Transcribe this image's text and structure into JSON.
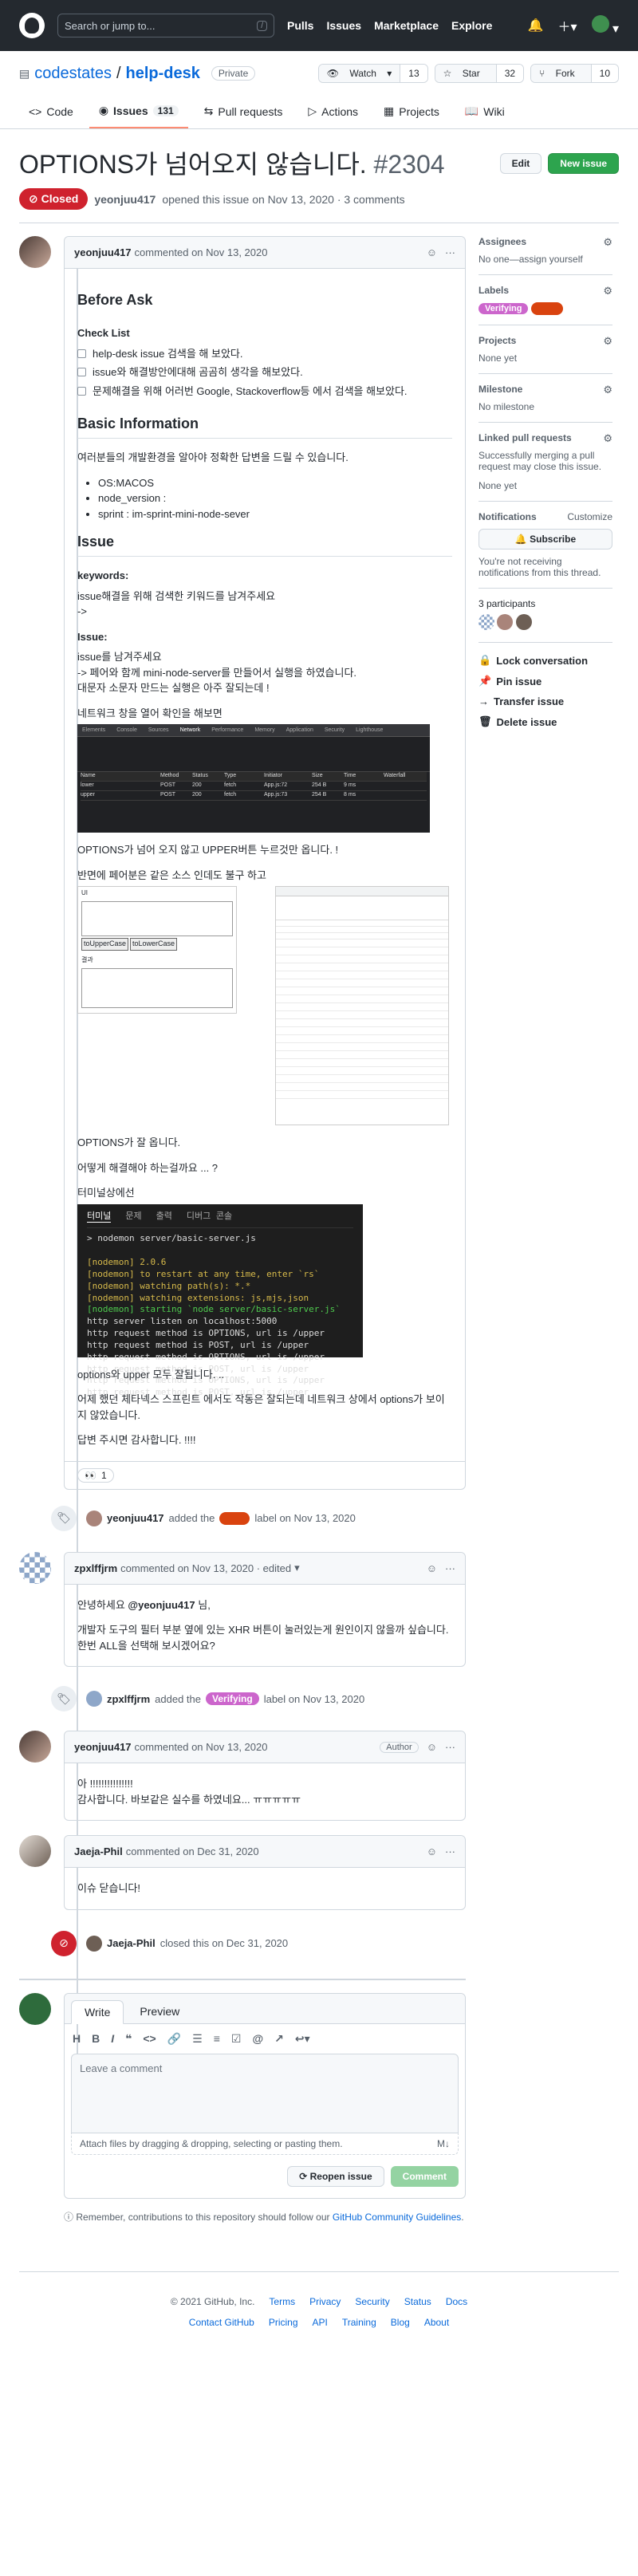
{
  "header": {
    "search_placeholder": "Search or jump to...",
    "search_kbd": "/",
    "nav": [
      "Pulls",
      "Issues",
      "Marketplace",
      "Explore"
    ]
  },
  "repo": {
    "owner": "codestates",
    "name": "help-desk",
    "visibility": "Private",
    "watch_label": "Watch",
    "watch_count": "13",
    "star_label": "Star",
    "star_count": "32",
    "fork_label": "Fork",
    "fork_count": "10",
    "tabs": [
      {
        "label": "Code",
        "icon": "code-icon"
      },
      {
        "label": "Issues",
        "icon": "issue-icon",
        "count": "131",
        "selected": true
      },
      {
        "label": "Pull requests",
        "icon": "pr-icon"
      },
      {
        "label": "Actions",
        "icon": "play-icon"
      },
      {
        "label": "Projects",
        "icon": "project-icon"
      },
      {
        "label": "Wiki",
        "icon": "book-icon"
      }
    ]
  },
  "issue": {
    "title": "OPTIONS가 넘어오지 않습니다.",
    "number": "#2304",
    "edit_label": "Edit",
    "new_issue_label": "New issue",
    "state": "Closed",
    "author": "yeonjuu417",
    "opened_text": "opened this issue on Nov 13, 2020 · 3 comments"
  },
  "first_comment": {
    "author": "yeonjuu417",
    "date_text": "commented on Nov 13, 2020",
    "before_ask": "Before Ask",
    "check_list": "Check List",
    "checks": [
      "help-desk issue 검색을 해 보았다.",
      "issue와 해결방안에대해 곰곰히 생각을 해보았다.",
      "문제해결을 위해 어러번 Google, Stackoverflow등 에서 검색을 해보았다."
    ],
    "basic_info": "Basic Information",
    "basic_intro": "여러분들의 개발환경을 알아야 정확한 답변을 드릴 수 있습니다.",
    "env": [
      "OS:MACOS",
      "node_version :",
      "sprint : im-sprint-mini-node-sever"
    ],
    "issue_heading": "Issue",
    "keywords_heading": "keywords:",
    "keywords_text1": "issue해결을 위해 검색한 키워드를 남겨주세요",
    "keywords_text2": "->",
    "issue_sub": "Issue:",
    "issue_text1": "issue를 남겨주세요",
    "issue_text2": "-> 페어와 함께 mini-node-server를 만들어서 실행을 하였습니다.",
    "issue_text3": "대문자 소문자 만드는 실행은 아주 잘되는데 !",
    "network_text": "네트워크 창을 열어 확인을 해보면",
    "options_text": "OPTIONS가 넘어 오지 않고 UPPER버튼 누르것만 옵니다. !",
    "repeat_text": "반면에 페어분은 같은 소스 인데도 불구 하고",
    "ok_text": "OPTIONS가 잘 옵니다.",
    "question_text": "어떻게 해결해야 하는걸까요 ... ?",
    "terminal_text": "터미널상에선",
    "both_text": "options와 upper 모두 잘됩니다. ..",
    "yesterday_text": "어제 했던 체타넥스 스프린트 에서도 작동은 잘되는데 네트워크 상에서 options가 보이지 않았습니다.",
    "thanks_text": "답변 주시면 감사합니다. !!!!",
    "reaction_emoji": "👀",
    "reaction_count": "1"
  },
  "screens": {
    "dev_tabs": [
      "Elements",
      "Console",
      "Sources",
      "Network",
      "Performance",
      "Memory",
      "Application",
      "Security",
      "Lighthouse"
    ],
    "dev_cols": [
      "Name",
      "Method",
      "Status",
      "Type",
      "Initiator",
      "Size",
      "Time",
      "Waterfall"
    ],
    "dev_rows": [
      [
        "lower",
        "POST",
        "200",
        "fetch",
        "App.js:72",
        "254 B",
        "9 ms"
      ],
      [
        "upper",
        "POST",
        "200",
        "fetch",
        "App.js:73",
        "254 B",
        "8 ms"
      ]
    ],
    "left_caption": "UI",
    "btn_upper": "toUpperCase",
    "btn_lower": "toLowerCase",
    "result_caption": "결과"
  },
  "terminal": {
    "tabs": [
      "터미널",
      "문제",
      "출력",
      "디버그 콘솔"
    ],
    "cmd": "> nodemon server/basic-server.js",
    "lines_yellow": [
      "[nodemon] 2.0.6",
      "[nodemon] to restart at any time, enter `rs`",
      "[nodemon] watching path(s): *.*",
      "[nodemon] watching extensions: js,mjs,json"
    ],
    "line_green": "[nodemon] starting `node server/basic-server.js`",
    "lines": [
      "http server listen on localhost:5000",
      "http request method is OPTIONS, url is /upper",
      "http request method is POST, url is /upper",
      "http request method is OPTIONS, url is /upper",
      "http request method is POST, url is /upper",
      "http request method is OPTIONS, url is /upper",
      "http request method is POST, url is /upper"
    ]
  },
  "timeline": {
    "ev1_actor": "yeonjuu417",
    "ev1_prefix": "added the",
    "ev1_label": "",
    "ev1_label_color": "#d9430f",
    "ev1_suffix": "label on Nov 13, 2020",
    "c2_author": "zpxlffjrm",
    "c2_date": "commented on Nov 13, 2020 · edited",
    "c2_line1_pre": "안녕하세요 ",
    "c2_mention": "@yeonjuu417",
    "c2_line1_post": " 님,",
    "c2_line2": "개발자 도구의 필터 부분 옆에 있는 XHR 버튼이 눌러있는게 원인이지 않을까 싶습니다.",
    "c2_line3": "한번 ALL을 선택해 보시겠어요?",
    "ev2_actor": "zpxlffjrm",
    "ev2_prefix": "added the",
    "ev2_label": "Verifying",
    "ev2_suffix": "label on Nov 13, 2020",
    "c3_author": "yeonjuu417",
    "c3_date": "commented on Nov 13, 2020",
    "c3_badge": "Author",
    "c3_line1": "아 !!!!!!!!!!!!!!!",
    "c3_line2": "감사합니다. 바보같은 실수를 하였네요... ㅠㅠㅠㅠㅠ",
    "c4_author": "Jaeja-Phil",
    "c4_date": "commented on Dec 31, 2020",
    "c4_text": "이슈 닫습니다!",
    "ev3_actor": "Jaeja-Phil",
    "ev3_text": "closed this on Dec 31, 2020"
  },
  "sidebar": {
    "assignees_title": "Assignees",
    "assignees_text": "No one—assign yourself",
    "labels_title": "Labels",
    "label1": "Verifying",
    "label2": "",
    "projects_title": "Projects",
    "projects_text": "None yet",
    "milestone_title": "Milestone",
    "milestone_text": "No milestone",
    "linked_title": "Linked pull requests",
    "linked_text": "Successfully merging a pull request may close this issue.",
    "linked_none": "None yet",
    "notif_title": "Notifications",
    "customize": "Customize",
    "subscribe": "Subscribe",
    "notif_text": "You're not receiving notifications from this thread.",
    "participants": "3 participants",
    "lock": "Lock conversation",
    "pin": "Pin issue",
    "transfer": "Transfer issue",
    "delete": "Delete issue"
  },
  "editor": {
    "write": "Write",
    "preview": "Preview",
    "placeholder": "Leave a comment",
    "attach": "Attach files by dragging & dropping, selecting or pasting them.",
    "reopen": "Reopen issue",
    "comment": "Comment",
    "remember_pre": "Remember, contributions to this repository should follow our ",
    "remember_link": "GitHub Community Guidelines",
    "remember_post": "."
  },
  "footer": {
    "copyright": "© 2021 GitHub, Inc.",
    "row1": [
      "Terms",
      "Privacy",
      "Security",
      "Status",
      "Docs"
    ],
    "row2": [
      "Contact GitHub",
      "Pricing",
      "API",
      "Training",
      "Blog",
      "About"
    ]
  },
  "colors": {
    "label_verifying": "#cc66cc",
    "label_orange": "#d9430f",
    "accent": "#0969da"
  }
}
